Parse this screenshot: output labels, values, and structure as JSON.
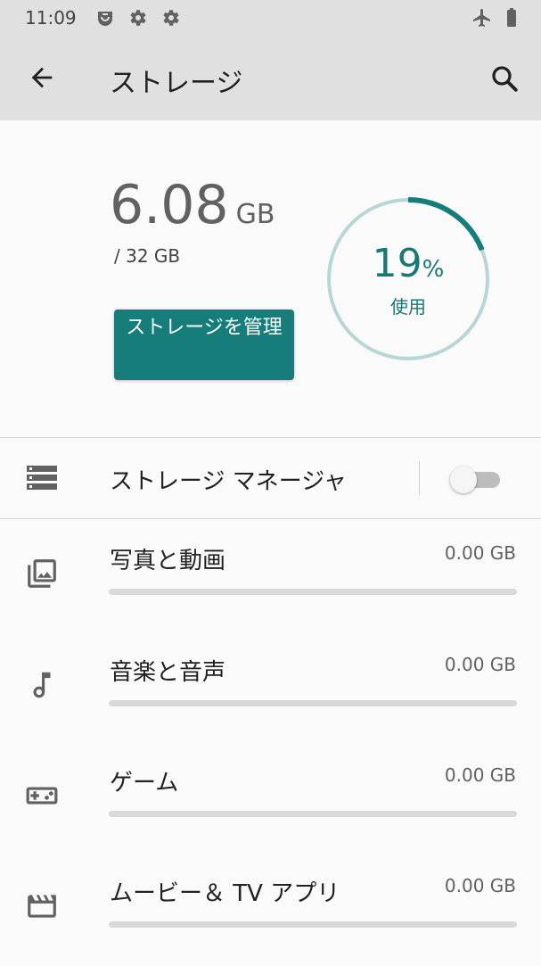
{
  "status_bar": {
    "time": "11:09",
    "icons": [
      "assistant-icon",
      "gear-icon",
      "gear-icon",
      "airplane-mode-icon",
      "battery-icon"
    ]
  },
  "app_bar": {
    "title": "ストレージ",
    "back_icon": "arrow-back-icon",
    "search_icon": "search-icon"
  },
  "summary": {
    "used_value": "6.08",
    "used_unit": "GB",
    "total": "/ 32 GB",
    "manage_button": "ストレージを管理",
    "percent_value": "19",
    "percent_symbol": "%",
    "percent_label": "使用",
    "percent_fraction": 0.19,
    "ring_color": "#167d7a",
    "ring_track_color": "#b9d6d7"
  },
  "storage_manager": {
    "label": "ストレージ マネージャ",
    "enabled": false
  },
  "categories": [
    {
      "label": "写真と動画",
      "size": "0.00 GB",
      "icon": "photos-icon",
      "fraction": 0
    },
    {
      "label": "音楽と音声",
      "size": "0.00 GB",
      "icon": "music-note-icon",
      "fraction": 0
    },
    {
      "label": "ゲーム",
      "size": "0.00 GB",
      "icon": "gamepad-icon",
      "fraction": 0
    },
    {
      "label": "ムービー＆ TV アプリ",
      "size": "0.00 GB",
      "icon": "movie-clapper-icon",
      "fraction": 0
    }
  ],
  "colors": {
    "accent": "#167d7a",
    "app_bar": "#e0e0e0",
    "background": "#fafafa"
  }
}
